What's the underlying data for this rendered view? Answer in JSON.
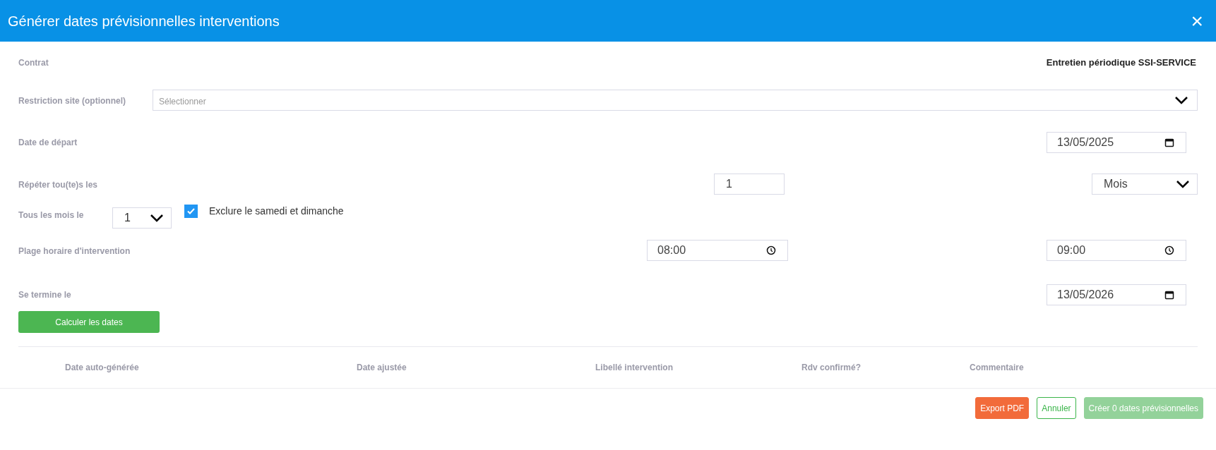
{
  "dialog": {
    "title": "Générer dates prévisionnelles interventions",
    "close": "×"
  },
  "form": {
    "contract": {
      "label": "Contrat",
      "value": "Entretien périodique SSI-SERVICE"
    },
    "site": {
      "label": "Restriction site (optionnel)",
      "placeholder": "Sélectionner"
    },
    "start": {
      "label": "Date de départ",
      "value": "13/05/2025"
    },
    "repeat": {
      "label": "Répéter tou(te)s les",
      "value": "1",
      "unit": "Mois"
    },
    "monthly": {
      "label": "Tous les mois le",
      "value": "1",
      "exclude_weekend": {
        "label": "Exclure le samedi et dimanche",
        "checked": true
      }
    },
    "time_range": {
      "label": "Plage horaire d'intervention",
      "from": "08:00",
      "to": "09:00"
    },
    "end": {
      "label": "Se termine le",
      "value": "13/05/2026"
    },
    "calculate_button": "Calculer les dates"
  },
  "table": {
    "columns": [
      "Date auto-générée",
      "Date ajustée",
      "Libellé intervention",
      "Rdv confirmé?",
      "Commentaire"
    ]
  },
  "footer": {
    "buttons": [
      {
        "label": "Export PDF",
        "kind": "danger"
      },
      {
        "label": "Annuler",
        "kind": "outline"
      },
      {
        "label": "Créer 0 dates prévisionnelles",
        "kind": "disabled"
      }
    ]
  }
}
